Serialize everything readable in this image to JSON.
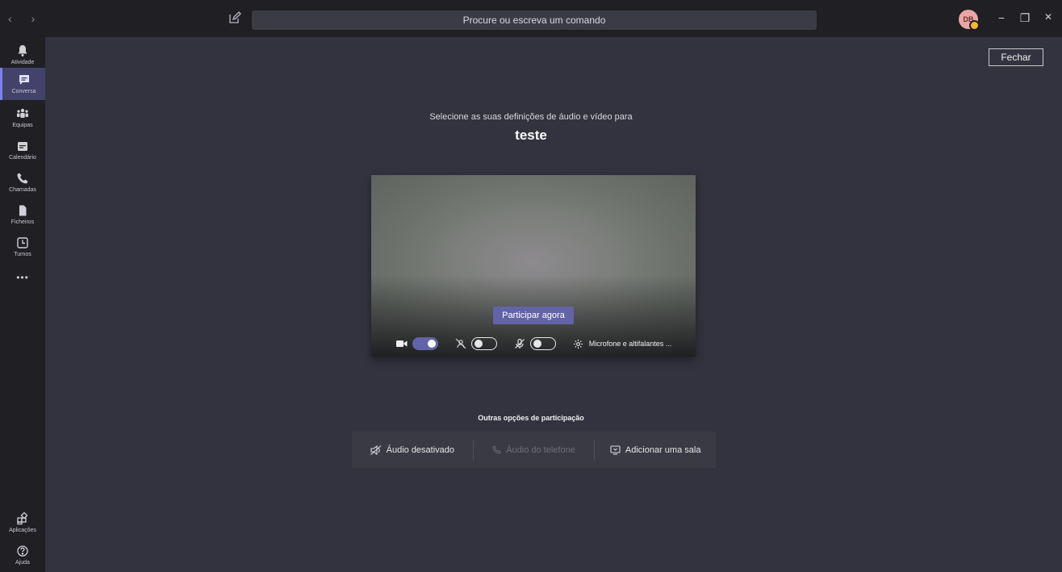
{
  "titlebar": {
    "back_arrow": "‹",
    "forward_arrow": "›",
    "search_placeholder": "Procure ou escreva um comando",
    "avatar_initials": "DB",
    "minimize": "−",
    "maximize": "❐",
    "close": "✕"
  },
  "rail": {
    "items": [
      {
        "label": "Atividade",
        "icon": "bell-icon"
      },
      {
        "label": "Conversa",
        "icon": "chat-icon"
      },
      {
        "label": "Equipas",
        "icon": "teams-icon"
      },
      {
        "label": "Calendário",
        "icon": "calendar-icon"
      },
      {
        "label": "Chamadas",
        "icon": "phone-icon"
      },
      {
        "label": "Ficheiros",
        "icon": "file-icon"
      },
      {
        "label": "Turnos",
        "icon": "clock-icon"
      }
    ],
    "more": "•••",
    "bottom": [
      {
        "label": "Aplicações",
        "icon": "apps-icon"
      },
      {
        "label": "Ajuda",
        "icon": "help-icon"
      }
    ]
  },
  "main": {
    "close_label": "Fechar",
    "subtitle": "Selecione as suas definições de áudio e vídeo para",
    "meeting_name": "teste",
    "join_label": "Participar agora",
    "device_label": "Microfone e altifalantes ...",
    "other_title": "Outras opções de participação",
    "options": {
      "audio_off": "Áudio desativado",
      "phone_audio": "Áudio do telefone",
      "add_room": "Adicionar uma sala"
    }
  },
  "colors": {
    "accent": "#6264a7",
    "background": "#33333f",
    "rail": "#1f1f24"
  }
}
